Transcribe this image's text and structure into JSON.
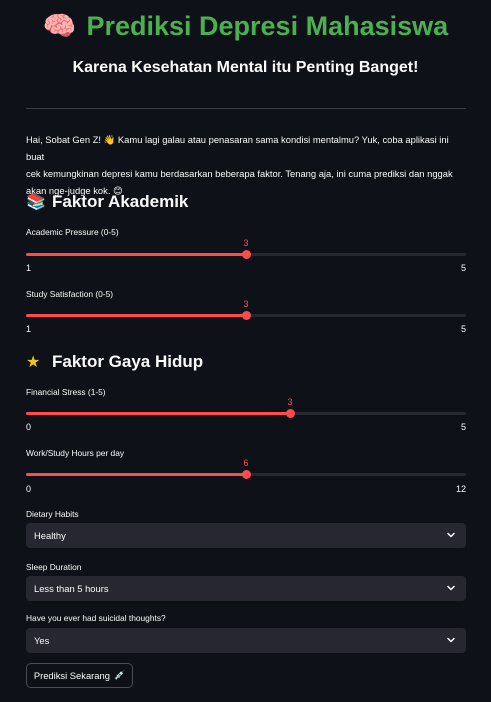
{
  "header": {
    "title_icon": "brain",
    "title": "Prediksi Depresi Mahasiswa",
    "subtitle": "Karena Kesehatan Mental itu Penting Banget!"
  },
  "intro": {
    "line1": "Hai, Sobat Gen Z! 👋 Kamu lagi galau atau penasaran sama kondisi mentalmu? Yuk, coba aplikasi ini buat",
    "line2": "cek kemungkinan depresi kamu berdasarkan beberapa faktor. Tenang aja, ini cuma prediksi dan nggak",
    "line3": "akan nge-judge kok. 😊"
  },
  "sections": {
    "akademik": {
      "icon": "books",
      "title": "Faktor Akademik"
    },
    "gaya_hidup": {
      "icon": "star",
      "title": "Faktor Gaya Hidup"
    }
  },
  "sliders": {
    "academic_pressure": {
      "label": "Academic Pressure (0-5)",
      "value": 3,
      "min": 1,
      "max": 5,
      "min_label": "1",
      "max_label": "5",
      "value_label": "3"
    },
    "study_satisfaction": {
      "label": "Study Satisfaction (0-5)",
      "value": 3,
      "min": 1,
      "max": 5,
      "min_label": "1",
      "max_label": "5",
      "value_label": "3"
    },
    "financial_stress": {
      "label": "Financial Stress (1-5)",
      "value": 3,
      "min": 0,
      "max": 5,
      "min_label": "0",
      "max_label": "5",
      "value_label": "3"
    },
    "work_hours": {
      "label": "Work/Study Hours per day",
      "value": 6,
      "min": 0,
      "max": 12,
      "min_label": "0",
      "max_label": "12",
      "value_label": "6"
    }
  },
  "selects": {
    "dietary": {
      "label": "Dietary Habits",
      "value": "Healthy"
    },
    "sleep": {
      "label": "Sleep Duration",
      "value": "Less than 5 hours"
    },
    "suicidal": {
      "label": "Have you ever had suicidal thoughts?",
      "value": "Yes"
    }
  },
  "button": {
    "label": "Prediksi Sekarang",
    "icon": "syringe"
  },
  "colors": {
    "title_green": "#4caf50",
    "accent_red": "#ff4b4b",
    "background": "#0e1117",
    "input_bg": "#262730"
  }
}
